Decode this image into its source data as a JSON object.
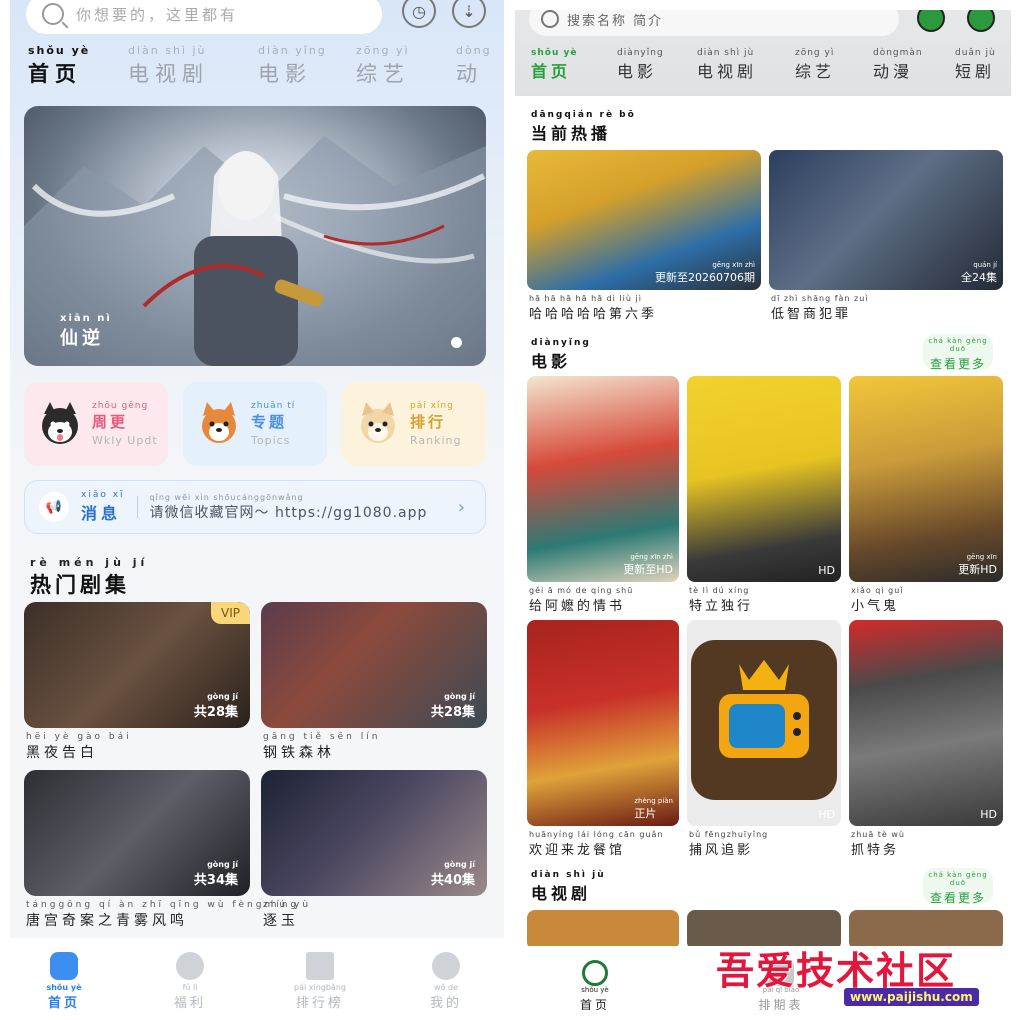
{
  "left": {
    "search": {
      "placeholder": "你想要的，这里都有"
    },
    "tabs": [
      {
        "py": "shǒu yè",
        "hz": "首页"
      },
      {
        "py": "diàn shì  jù",
        "hz": "电视剧"
      },
      {
        "py": "diàn yǐng",
        "hz": "电影"
      },
      {
        "py": "zōng  yì",
        "hz": "综艺"
      },
      {
        "py": "dòng",
        "hz": "动"
      }
    ],
    "banner": {
      "py": "xiān  nì",
      "hz": "仙逆"
    },
    "quick": [
      {
        "py": "zhōu gēng",
        "hz": "周更",
        "en": "Wkly Updt",
        "color": "#e75a7c",
        "bg": "#fde8ee"
      },
      {
        "py": "zhuān  tí",
        "hz": "专题",
        "en": "Topics",
        "color": "#4c8fe2",
        "bg": "#e4f0fc"
      },
      {
        "py": "pái xíng",
        "hz": "排行",
        "en": "Ranking",
        "color": "#d6a02a",
        "bg": "#fdf3dc"
      }
    ],
    "notice": {
      "label_py": "xiāo  xī",
      "label_hz": "消息",
      "text_py": "qǐng wēi xìn shōucánggōnwǎng",
      "text": "请微信收藏官网～ https://gg1080.app"
    },
    "section": {
      "py": "rè mén jù  jí",
      "hz": "热门剧集"
    },
    "cards": [
      {
        "title_py": "hēi  yè  gào  bái",
        "title": "黑夜告白",
        "badge": "VIP",
        "cnt_py": "gòng    jí",
        "cnt": "共28集"
      },
      {
        "title_py": "gāng tiě  sēn  lín",
        "title": "钢铁森林",
        "badge": "",
        "cnt_py": "gòng    jí",
        "cnt": "共28集"
      },
      {
        "title_py": "tánggōng  qí  àn  zhī qīng wù fèngmíng",
        "title": "唐宫奇案之青雾风鸣",
        "badge": "",
        "cnt_py": "gòng    jí",
        "cnt": "共34集"
      },
      {
        "title_py": "zhú  yù",
        "title": "逐玉",
        "badge": "",
        "cnt_py": "gòng    jí",
        "cnt": "共40集"
      }
    ],
    "nav": [
      {
        "py": "shǒu yè",
        "hz": "首页"
      },
      {
        "py": "fú  lì",
        "hz": "福利"
      },
      {
        "py": "pái xíngbǎng",
        "hz": "排行榜"
      },
      {
        "py": "wǒ  de",
        "hz": "我的"
      }
    ]
  },
  "right": {
    "search": {
      "placeholder": "搜索名称 简介"
    },
    "tabs": [
      {
        "py": "shǒu  yè",
        "hz": "首页"
      },
      {
        "py": "diànyǐng",
        "hz": "电影"
      },
      {
        "py": "diàn shì  jù",
        "hz": "电视剧"
      },
      {
        "py": "zōng  yì",
        "hz": "综艺"
      },
      {
        "py": "dòngmàn",
        "hz": "动漫"
      },
      {
        "py": "duǎn  jù",
        "hz": "短剧"
      }
    ],
    "hot": {
      "py": "dāngqián  rè   bō",
      "hz": "当前热播",
      "items": [
        {
          "title_py": "hā   hā   hā   hā   hā   dì  liù  jì",
          "title": "哈哈哈哈哈第六季",
          "tag_py": "gēng xīn  zhì",
          "tag": "更新至20260706期"
        },
        {
          "title_py": "dī   zhì shāng fàn  zuì",
          "title": "低智商犯罪",
          "tag_py": "quán    jí",
          "tag": "全24集"
        }
      ]
    },
    "movies": {
      "py": "diànyǐng",
      "hz": "电影",
      "more_py": "chá  kàn gèng duō",
      "more": "查看更多",
      "items": [
        {
          "title_py": "gěi   ā    mó  de  qíng shū",
          "title": "给阿嬷的情书",
          "tag_py": "gēng xīn  zhì",
          "tag": "更新至HD"
        },
        {
          "title_py": "tè    lì   dú  xíng",
          "title": "特立独行",
          "tag_py": "",
          "tag": "HD"
        },
        {
          "title_py": "xiǎo  qì  guǐ",
          "title": "小气鬼",
          "tag_py": "gēng xīn",
          "tag": "更新HD"
        },
        {
          "title_py": "huānyíng  lái  lóng cān guǎn",
          "title": "欢迎来龙餐馆",
          "tag_py": "zhèng piàn",
          "tag": "正片"
        },
        {
          "title_py": "bǔ  fēngzhuīyǐng",
          "title": "捕风追影",
          "tag_py": "",
          "tag": "HD"
        },
        {
          "title_py": "zhuā  tè   wù",
          "title": "抓特务",
          "tag_py": "",
          "tag": "HD"
        }
      ]
    },
    "tv": {
      "py": "diàn shì  jù",
      "hz": "电视剧",
      "more_py": "chá  kàn gèng duō",
      "more": "查看更多"
    },
    "nav": [
      {
        "py": "shǒu  yè",
        "hz": "首页"
      },
      {
        "py": "pái qī  biǎo",
        "hz": "排期表"
      }
    ]
  },
  "watermark": {
    "text": "吾爱技术社区",
    "url": "www.paijishu.com"
  }
}
